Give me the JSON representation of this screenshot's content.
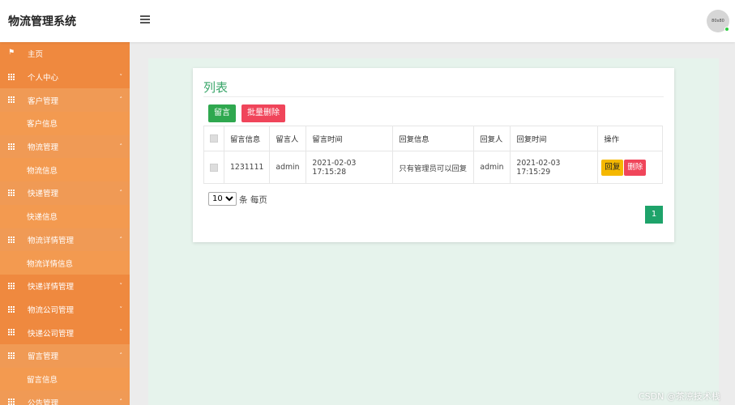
{
  "header": {
    "title": "物流管理系统",
    "avatar_text": "80x80"
  },
  "sidebar": {
    "items": [
      {
        "label": "主页",
        "icon": "flag-icon",
        "type": "parent",
        "chevron": ""
      },
      {
        "label": "个人中心",
        "icon": "grid-icon",
        "type": "parent",
        "chevron": "⌄"
      },
      {
        "label": "客户管理",
        "icon": "grid-icon",
        "type": "open-parent",
        "chevron": "⌃"
      },
      {
        "label": "客户信息",
        "icon": "",
        "type": "child",
        "chevron": ""
      },
      {
        "label": "物流管理",
        "icon": "grid-icon",
        "type": "open-parent",
        "chevron": "⌃"
      },
      {
        "label": "物流信息",
        "icon": "",
        "type": "child",
        "chevron": ""
      },
      {
        "label": "快递管理",
        "icon": "grid-icon",
        "type": "open-parent",
        "chevron": "⌃"
      },
      {
        "label": "快递信息",
        "icon": "",
        "type": "child",
        "chevron": ""
      },
      {
        "label": "物流详情管理",
        "icon": "grid-icon",
        "type": "open-parent",
        "chevron": "⌃"
      },
      {
        "label": "物流详情信息",
        "icon": "",
        "type": "child",
        "chevron": ""
      },
      {
        "label": "快递详情管理",
        "icon": "grid-icon",
        "type": "parent",
        "chevron": "⌄"
      },
      {
        "label": "物流公司管理",
        "icon": "grid-icon",
        "type": "parent",
        "chevron": "⌄"
      },
      {
        "label": "快递公司管理",
        "icon": "grid-icon",
        "type": "parent",
        "chevron": "⌄"
      },
      {
        "label": "留言管理",
        "icon": "grid-icon",
        "type": "open-parent",
        "chevron": "⌃"
      },
      {
        "label": "留言信息",
        "icon": "",
        "type": "child",
        "chevron": ""
      },
      {
        "label": "公告管理",
        "icon": "grid-icon",
        "type": "open-parent",
        "chevron": "⌃"
      }
    ]
  },
  "main": {
    "title": "列表",
    "toolbar": {
      "add_label": "留言",
      "batch_delete_label": "批量删除"
    },
    "table": {
      "columns": [
        "留言信息",
        "留言人",
        "留言时间",
        "回复信息",
        "回复人",
        "回复时间",
        "操作"
      ],
      "rows": [
        {
          "message": "1231111",
          "author": "admin",
          "time": "2021-02-03 17:15:28",
          "reply": "只有管理员可以回复",
          "replier": "admin",
          "reply_time": "2021-02-03 17:15:29",
          "reply_btn": "回复",
          "delete_btn": "删除"
        }
      ]
    },
    "pagination": {
      "page_size": "10",
      "per_page_text": "条 每页",
      "current_page": "1"
    }
  },
  "watermark": "CSDN @茶凉技术栈",
  "colors": {
    "sidebar": "#ef893f",
    "accent_green": "#3aa66a",
    "danger": "#f0455a",
    "warning": "#f5b800"
  }
}
